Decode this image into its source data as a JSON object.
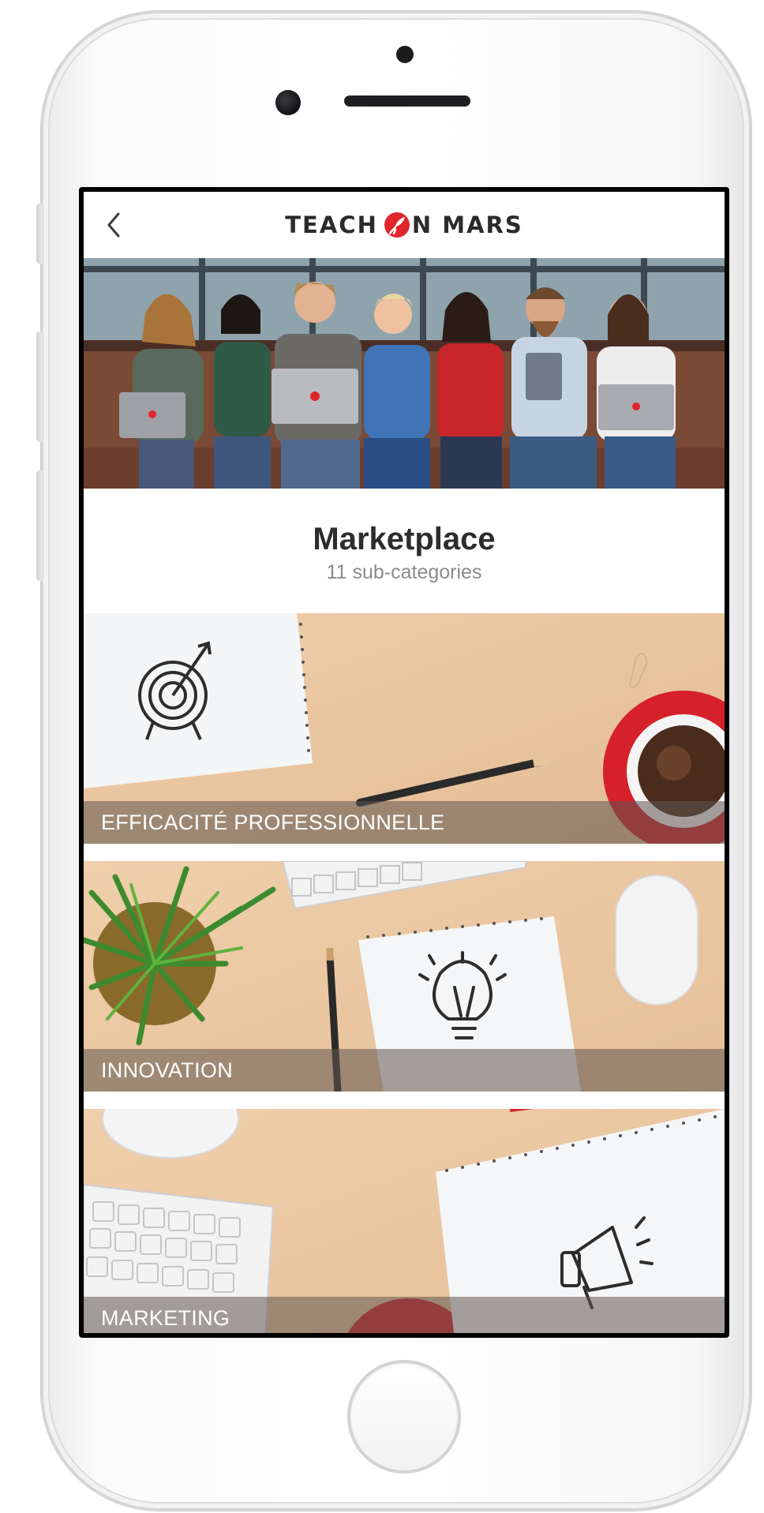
{
  "app": {
    "brand_left": "TEACH",
    "brand_right": "N MARS",
    "back_label": "Back"
  },
  "header": {
    "title": "Marketplace",
    "subtitle": "11 sub-categories"
  },
  "categories": [
    {
      "label": "EFFICACITÉ PROFESSIONNELLE",
      "icon": "target-icon"
    },
    {
      "label": "INNOVATION",
      "icon": "lightbulb-icon"
    },
    {
      "label": "MARKETING",
      "icon": "megaphone-icon"
    }
  ],
  "colors": {
    "brand_red": "#e0262d",
    "text_dark": "#2d2d2d",
    "text_muted": "#8b8b8b",
    "desk_wood": "#e9c7a3"
  }
}
